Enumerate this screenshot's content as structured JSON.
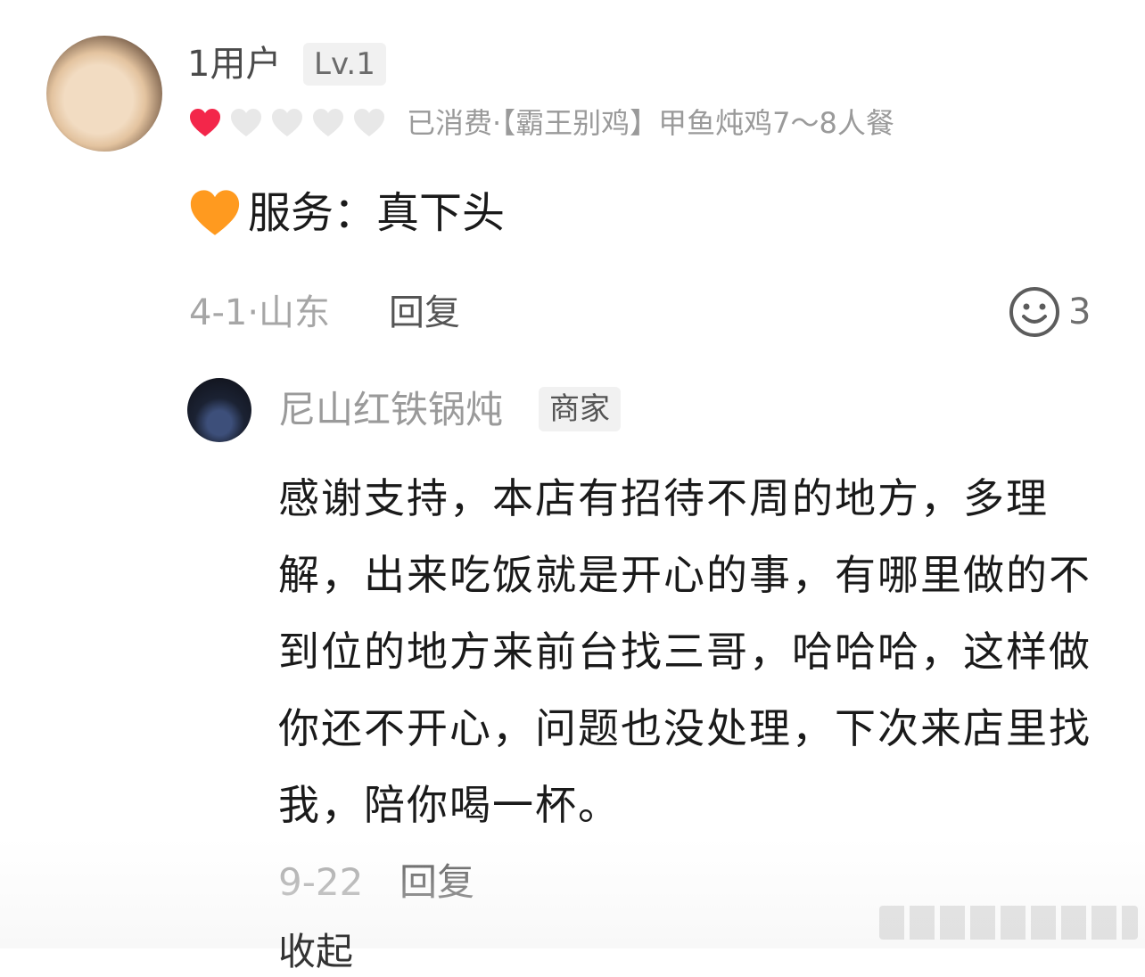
{
  "comment": {
    "username": "1用户",
    "level": "Lv.1",
    "rating": {
      "filled": 1,
      "total": 5
    },
    "purchase": "已消费·【霸王别鸡】甲鱼炖鸡7～8人餐",
    "review_text": "服务：真下头",
    "date_location": "4-1·山东",
    "reply_label": "回复",
    "like_count": "3"
  },
  "merchant_reply": {
    "name": "尼山红铁锅炖",
    "badge": "商家",
    "text": "感谢支持，本店有招待不周的地方，多理解，出来吃饭就是开心的事，有哪里做的不到位的地方来前台找三哥，哈哈哈，这样做你还不开心，问题也没处理，下次来店里找我，陪你喝一杯。",
    "date": "9-22",
    "reply_label": "回复"
  },
  "truncated_text": "收起",
  "colors": {
    "heart_filled": "#f3264a",
    "heart_empty": "#e8e8e8",
    "orange_heart": "#ff9a1f"
  }
}
